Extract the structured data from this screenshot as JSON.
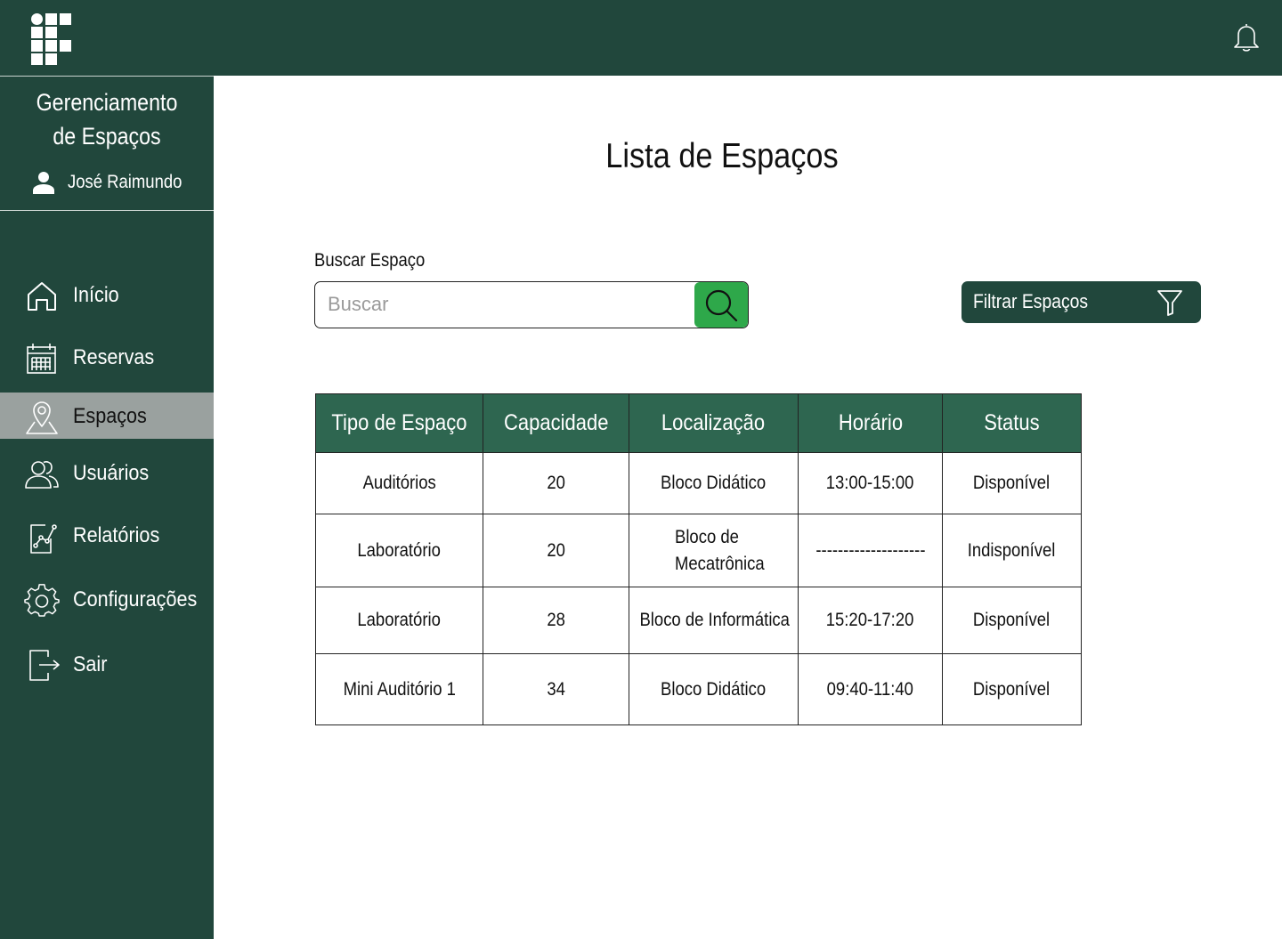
{
  "header": {
    "logo_icon": "institution-logo-icon",
    "bell_icon": "notification-bell-icon"
  },
  "sidebar": {
    "title_line1": "Gerenciamento",
    "title_line2": "de Espaços",
    "user_name": "José Raimundo",
    "user_icon": "user-icon",
    "items": [
      {
        "label": "Início",
        "icon": "home-icon",
        "active": false
      },
      {
        "label": "Reservas",
        "icon": "calendar-icon",
        "active": false
      },
      {
        "label": "Espaços",
        "icon": "location-pin-icon",
        "active": true
      },
      {
        "label": "Usuários",
        "icon": "users-icon",
        "active": false
      },
      {
        "label": "Relatórios",
        "icon": "report-chart-icon",
        "active": false
      },
      {
        "label": "Configurações",
        "icon": "gear-icon",
        "active": false
      },
      {
        "label": "Sair",
        "icon": "logout-icon",
        "active": false
      }
    ]
  },
  "main": {
    "title": "Lista de Espaços",
    "search": {
      "label": "Buscar Espaço",
      "placeholder": "Buscar",
      "value": ""
    },
    "filter_label": "Filtrar Espaços",
    "table": {
      "headers": [
        "Tipo de Espaço",
        "Capacidade",
        "Localização",
        "Horário",
        "Status"
      ],
      "rows": [
        [
          "Auditórios",
          "20",
          "Bloco Didático",
          "13:00-15:00",
          "Disponível"
        ],
        [
          "Laboratório",
          "20",
          "Bloco de Mecatrônica",
          "--------------------",
          "Indisponível"
        ],
        [
          "Laboratório",
          "28",
          "Bloco de Informática",
          "15:20-17:20",
          "Disponível"
        ],
        [
          "Mini Auditório 1",
          "34",
          "Bloco Didático",
          "09:40-11:40",
          "Disponível"
        ]
      ]
    }
  },
  "colors": {
    "primary_dark_green": "#21473c",
    "table_header_green": "#2e6650",
    "search_button_green": "#2ea84a",
    "active_nav_gray": "#9aa19f"
  }
}
